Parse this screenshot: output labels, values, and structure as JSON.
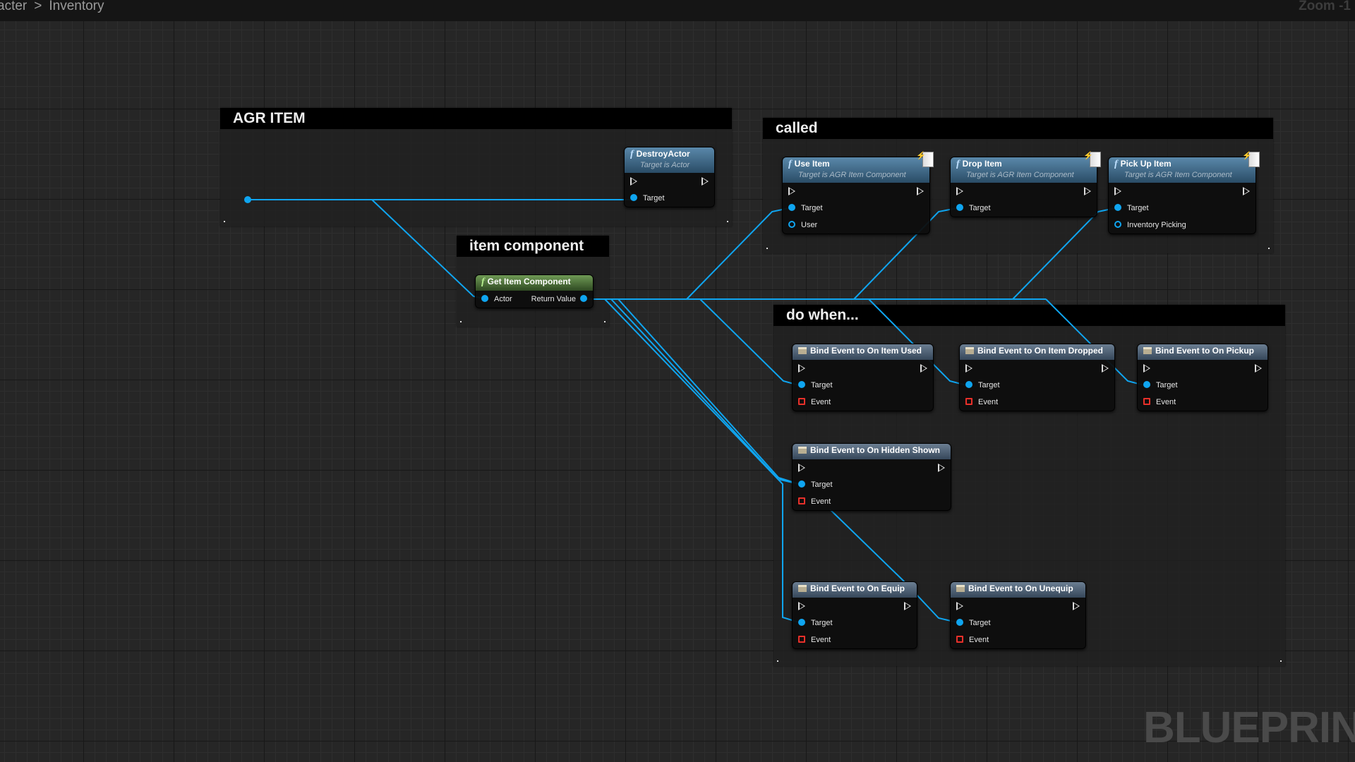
{
  "header": {
    "breadcrumb_parent": "acter",
    "breadcrumb_current": "Inventory",
    "zoom": "Zoom -1"
  },
  "watermark": "BLUEPRINT",
  "colors": {
    "wire": "#0fa5f0",
    "exec_pin": "#dddddd",
    "event_pin": "#e8302a",
    "function_header": "#3d6a8c",
    "pure_header": "#4b6b3a",
    "bind_header": "#4a5a6a"
  },
  "comments": [
    {
      "title": "AGR ITEM"
    },
    {
      "title": "item component"
    },
    {
      "title": "called"
    },
    {
      "title": "do when..."
    }
  ],
  "nodes": [
    {
      "kind": "func",
      "icon": "function-icon",
      "title": "DestroyActor",
      "subtitle": "Target is Actor",
      "exec": true,
      "pins": [
        {
          "type": "in",
          "label": "Target"
        }
      ]
    },
    {
      "kind": "pure",
      "icon": "function-icon",
      "title": "Get Item Component",
      "exec": false,
      "pins": [
        {
          "type": "in",
          "label": "Actor",
          "out": "Return Value"
        }
      ]
    },
    {
      "kind": "func",
      "icon": "function-icon",
      "title": "Use Item",
      "subtitle": "Target is AGR Item Component",
      "event_icon": true,
      "exec": true,
      "pins": [
        {
          "type": "in",
          "label": "Target"
        },
        {
          "type": "hollow",
          "label": "User"
        }
      ]
    },
    {
      "kind": "func",
      "icon": "function-icon",
      "title": "Drop Item",
      "subtitle": "Target is AGR Item Component",
      "event_icon": true,
      "exec": true,
      "pins": [
        {
          "type": "in",
          "label": "Target"
        }
      ]
    },
    {
      "kind": "func",
      "icon": "function-icon",
      "title": "Pick Up Item",
      "subtitle": "Target is AGR Item Component",
      "event_icon": true,
      "exec": true,
      "pins": [
        {
          "type": "in",
          "label": "Target"
        },
        {
          "type": "hollow",
          "label": "Inventory Picking"
        }
      ]
    },
    {
      "kind": "bind",
      "icon": "bind-event-icon",
      "title": "Bind Event to On Item Used",
      "exec": true,
      "pins": [
        {
          "type": "in",
          "label": "Target"
        },
        {
          "type": "event",
          "label": "Event"
        }
      ]
    },
    {
      "kind": "bind",
      "icon": "bind-event-icon",
      "title": "Bind Event to On Item Dropped",
      "exec": true,
      "pins": [
        {
          "type": "in",
          "label": "Target"
        },
        {
          "type": "event",
          "label": "Event"
        }
      ]
    },
    {
      "kind": "bind",
      "icon": "bind-event-icon",
      "title": "Bind Event to On Pickup",
      "exec": true,
      "pins": [
        {
          "type": "in",
          "label": "Target"
        },
        {
          "type": "event",
          "label": "Event"
        }
      ]
    },
    {
      "kind": "bind",
      "icon": "bind-event-icon",
      "title": "Bind Event to On Hidden Shown",
      "exec": true,
      "pins": [
        {
          "type": "in",
          "label": "Target"
        },
        {
          "type": "event",
          "label": "Event"
        }
      ]
    },
    {
      "kind": "bind",
      "icon": "bind-event-icon",
      "title": "Bind Event to On Equip",
      "exec": true,
      "pins": [
        {
          "type": "in",
          "label": "Target"
        },
        {
          "type": "event",
          "label": "Event"
        }
      ]
    },
    {
      "kind": "bind",
      "icon": "bind-event-icon",
      "title": "Bind Event to On Unequip",
      "exec": true,
      "pins": [
        {
          "type": "in",
          "label": "Target"
        },
        {
          "type": "event",
          "label": "Event"
        }
      ]
    }
  ]
}
